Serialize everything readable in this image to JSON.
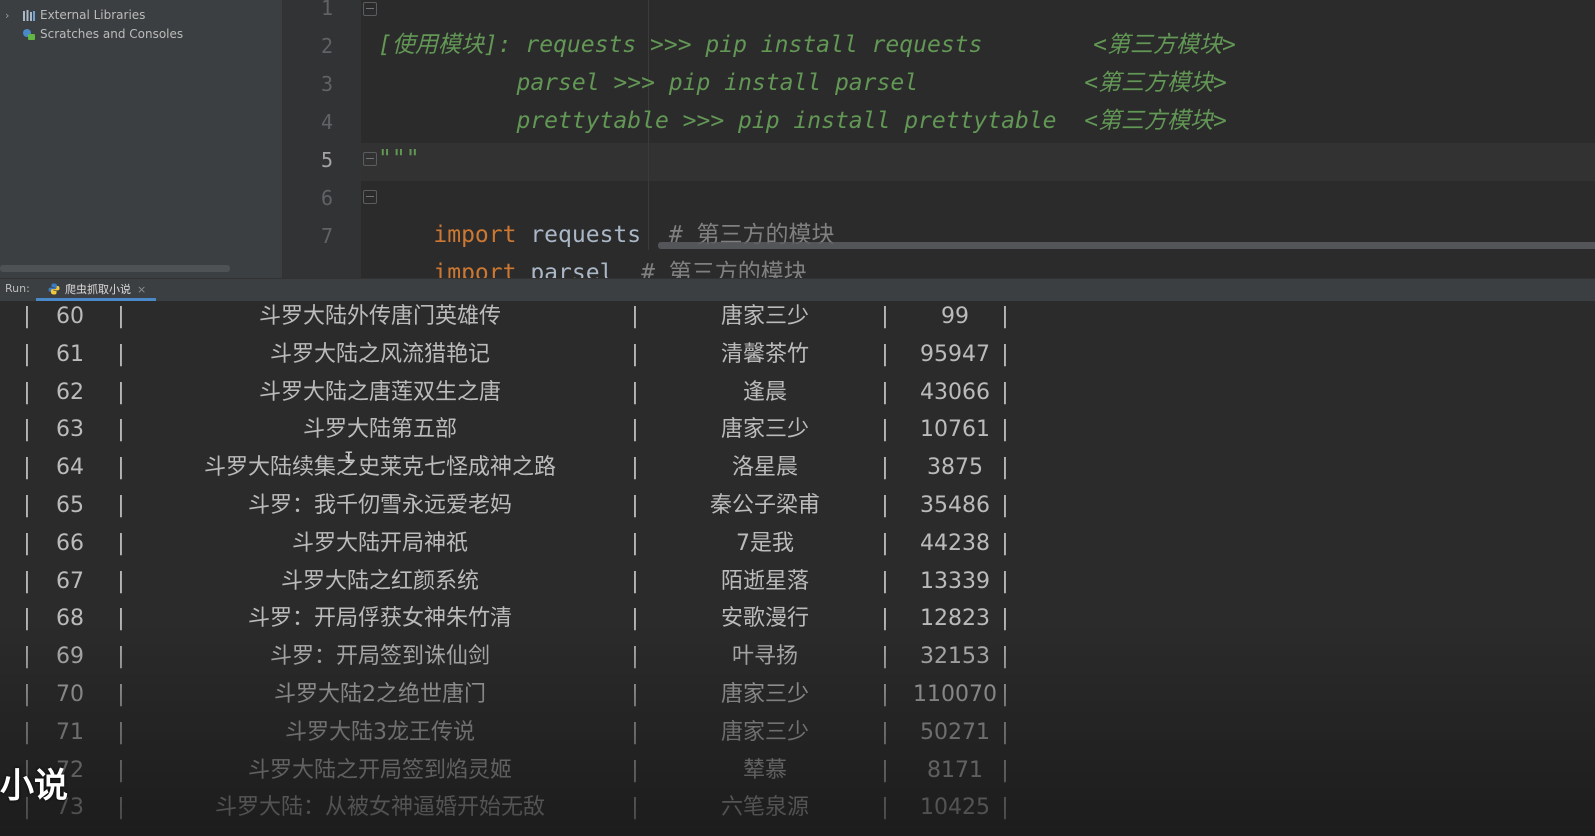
{
  "project_tree": {
    "items": [
      {
        "label": "External Libraries",
        "icon": "library-icon"
      },
      {
        "label": "Scratches and Consoles",
        "icon": "scratches-icon"
      }
    ]
  },
  "editor": {
    "line_numbers": [
      "1",
      "2",
      "3",
      "4",
      "5",
      "6",
      "7"
    ],
    "current_line": "5",
    "lines": {
      "l1": "\"\"\"",
      "l2": "[使用模块]: requests >>> pip install requests        <第三方模块>",
      "l3": "          parsel >>> pip install parsel            <第三方模块>",
      "l4": "          prettytable >>> pip install prettytable  <第三方模块>",
      "l5": "\"\"\"",
      "l6_kw": "import",
      "l6_id": " requests  ",
      "l6_cm": "# 第三方的模块",
      "l7_kw": "import",
      "l7_id": " parsel  ",
      "l7_cm": "# 第三方的模块"
    }
  },
  "run": {
    "label": "Run:",
    "tab_label": "爬虫抓取小说",
    "close_symbol": "×"
  },
  "console": {
    "bar": "|",
    "rows": [
      {
        "idx": "60",
        "title": "斗罗大陆外传唐门英雄传",
        "author": "唐家三少",
        "num": "99"
      },
      {
        "idx": "61",
        "title": "斗罗大陆之风流猎艳记",
        "author": "清馨茶竹",
        "num": "95947"
      },
      {
        "idx": "62",
        "title": "斗罗大陆之唐莲双生之唐",
        "author": "逢晨",
        "num": "43066"
      },
      {
        "idx": "63",
        "title": "斗罗大陆第五部",
        "author": "唐家三少",
        "num": "10761"
      },
      {
        "idx": "64",
        "title": "斗罗大陆续集之史莱克七怪成神之路",
        "author": "洛星晨",
        "num": "3875"
      },
      {
        "idx": "65",
        "title": "斗罗：我千仞雪永远爱老妈",
        "author": "秦公子梁甫",
        "num": "35486"
      },
      {
        "idx": "66",
        "title": "斗罗大陆开局神祇",
        "author": "7是我",
        "num": "44238"
      },
      {
        "idx": "67",
        "title": "斗罗大陆之红颜系统",
        "author": "陌逝星落",
        "num": "13339"
      },
      {
        "idx": "68",
        "title": "斗罗：开局俘获女神朱竹清",
        "author": "安歌漫行",
        "num": "12823"
      },
      {
        "idx": "69",
        "title": "斗罗：开局签到诛仙剑",
        "author": "叶寻扬",
        "num": "32153"
      },
      {
        "idx": "70",
        "title": "斗罗大陆2之绝世唐门",
        "author": "唐家三少",
        "num": "110070"
      },
      {
        "idx": "71",
        "title": "斗罗大陆3龙王传说",
        "author": "唐家三少",
        "num": "50271"
      },
      {
        "idx": "72",
        "title": "斗罗大陆之开局签到焰灵姬",
        "author": "辇慕",
        "num": "8171"
      },
      {
        "idx": "73",
        "title": "斗罗大陆：从被女神逼婚开始无敌",
        "author": "六笔泉源",
        "num": "10425"
      }
    ]
  },
  "overlay": {
    "caption": "小说"
  }
}
